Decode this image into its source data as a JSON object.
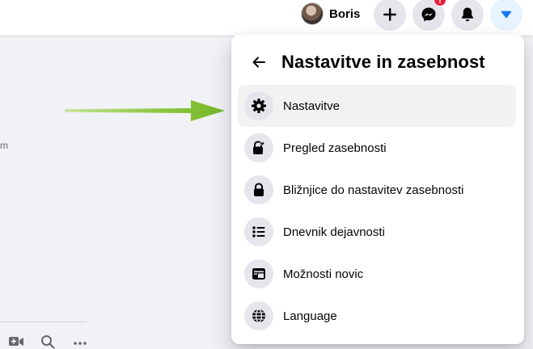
{
  "header": {
    "profile_name": "Boris",
    "messenger_badge": "!"
  },
  "background": {
    "partial_text": "m"
  },
  "menu": {
    "title": "Nastavitve in zasebnost",
    "items": [
      {
        "label": "Nastavitve",
        "icon": "gear-icon"
      },
      {
        "label": "Pregled zasebnosti",
        "icon": "lock-heart-icon"
      },
      {
        "label": "Bližnjice do nastavitev zasebnosti",
        "icon": "lock-icon"
      },
      {
        "label": "Dnevnik dejavnosti",
        "icon": "list-icon"
      },
      {
        "label": "Možnosti novic",
        "icon": "news-feed-icon"
      },
      {
        "label": "Language",
        "icon": "globe-icon"
      }
    ]
  },
  "colors": {
    "background": "#f0f2f5",
    "panel": "#ffffff",
    "icon_circle": "#e4e6eb",
    "accent": "#1877f2",
    "badge": "#e41e3f",
    "annotation_arrow": "#8cc63f"
  }
}
